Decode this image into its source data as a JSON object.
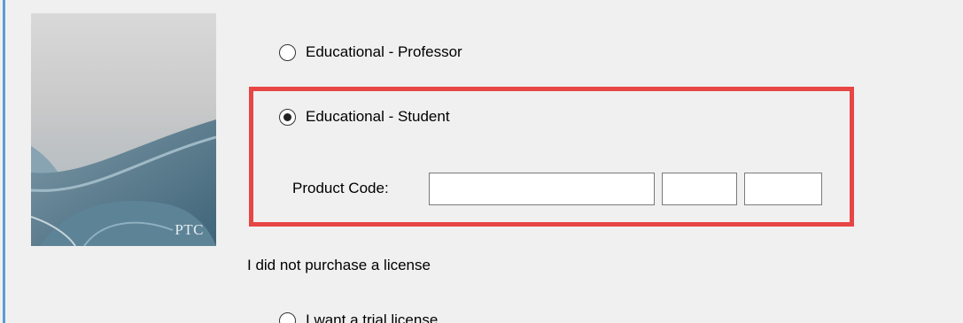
{
  "options": {
    "professor_label": "Educational - Professor",
    "student_label": "Educational - Student",
    "student_selected": true,
    "professor_selected": false
  },
  "product_code": {
    "label": "Product Code:",
    "part1": "",
    "part2": "",
    "part3": ""
  },
  "no_license": {
    "heading": "I did not purchase a license",
    "trial_label": "I want a trial license"
  },
  "banner": {
    "logo_text": "PTC"
  },
  "colors": {
    "highlight": "#e84545",
    "window_bg": "#f0f0f0",
    "accent_border": "#5b9bd5"
  }
}
